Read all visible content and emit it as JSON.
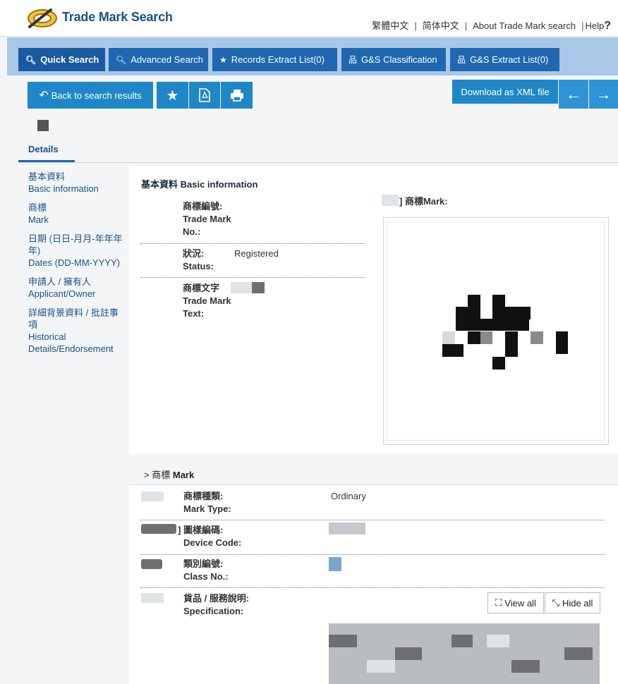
{
  "header": {
    "brand": "Trade Mark Search",
    "links": [
      "繁體中文",
      "简体中文",
      "About Trade Mark search",
      "Help"
    ],
    "help_glyph": "?"
  },
  "nav": {
    "tabs": [
      {
        "label": "Quick Search",
        "icon": "search-icon"
      },
      {
        "label": "Advanced Search",
        "icon": "search-icon"
      },
      {
        "label": "Records Extract List(0)",
        "icon": "star-icon"
      },
      {
        "label": "G&S Classification",
        "icon": "sitemap-icon"
      },
      {
        "label": "G&S Extract List(0)",
        "icon": "sitemap-star-icon"
      }
    ]
  },
  "toolbar": {
    "back_label": "Back to search results",
    "download_label": "Download as XML file",
    "icons": [
      "back-arrow-icon",
      "star-icon",
      "pdf-icon",
      "print-icon",
      "arrow-left-icon",
      "arrow-right-icon"
    ]
  },
  "details": {
    "tab_label": "Details",
    "sidenav": [
      "基本資料",
      "Basic information",
      "商標",
      "Mark",
      "日期 (日日-月月-年年年年)",
      "Dates (DD-MM-YYYY)",
      "申請人 / 擁有人",
      "Applicant/Owner",
      "詳細背景資料 / 批註事項",
      "Historical Details/Endorsement"
    ]
  },
  "basic": {
    "title": "基本資料 Basic information",
    "trade_mark_no_label_zh": "商標編號:",
    "trade_mark_no_label_en": "Trade Mark No.:",
    "status_label_zh": "狀況:",
    "status_label_en": "Status:",
    "status_value": "Registered",
    "trade_mark_text_label_zh": "商標文字",
    "trade_mark_text_label_en": "Trade Mark Text:",
    "mark_label": "] 商標Mark:"
  },
  "mark_section": {
    "title_zh": "商標",
    "title_en": "Mark",
    "mark_type_label_zh": "商標種類:",
    "mark_type_label_en": "Mark Type:",
    "mark_type_value": "Ordinary",
    "device_code_label_zh": "] 圖樣編碼:",
    "device_code_label_en": "Device Code:",
    "class_no_label_zh": "類別編號:",
    "class_no_label_en": "Class No.:",
    "spec_label_zh": "貨品 / 服務說明:",
    "spec_label_en": "Specification:",
    "view_all": "View all",
    "hide_all": "Hide all"
  },
  "colors": {
    "brand": "#1f4f8b",
    "nav_band": "#a9c7e6",
    "tab": "#1f67b1",
    "button": "#1f87c8"
  }
}
